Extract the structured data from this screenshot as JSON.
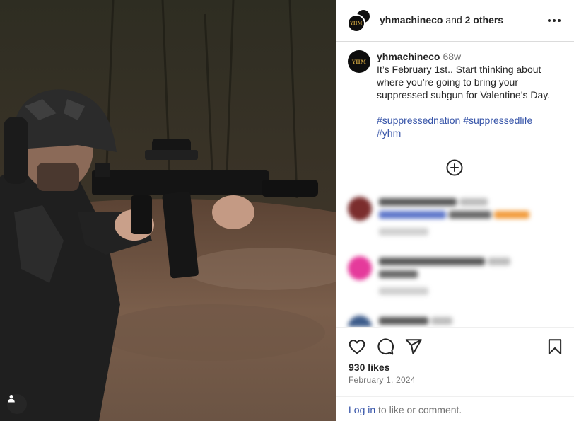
{
  "photo": {
    "alt_icon": "person-tag-icon"
  },
  "header": {
    "username": "yhmachineco",
    "connector": " and ",
    "others": "2 others",
    "logo_text": "YHM"
  },
  "caption": {
    "username": "yhmachineco",
    "age": "68w",
    "text": "It’s February 1st.. Start thinking about where you’re going to bring your suppressed subgun for Valentine’s Day.",
    "hashtags": [
      "#suppressednation",
      "#suppressedlife",
      "#yhm"
    ]
  },
  "load_more_icon": "plus-circle-icon",
  "actions": {
    "like_icon": "heart-icon",
    "comment_icon": "comment-icon",
    "share_icon": "send-icon",
    "save_icon": "bookmark-icon"
  },
  "likes": "930 likes",
  "date": "February 1, 2024",
  "login": {
    "link": "Log in",
    "rest": " to like or comment."
  },
  "colors": {
    "link": "#3553a8",
    "muted": "#737373",
    "border": "#dbdbdb"
  }
}
